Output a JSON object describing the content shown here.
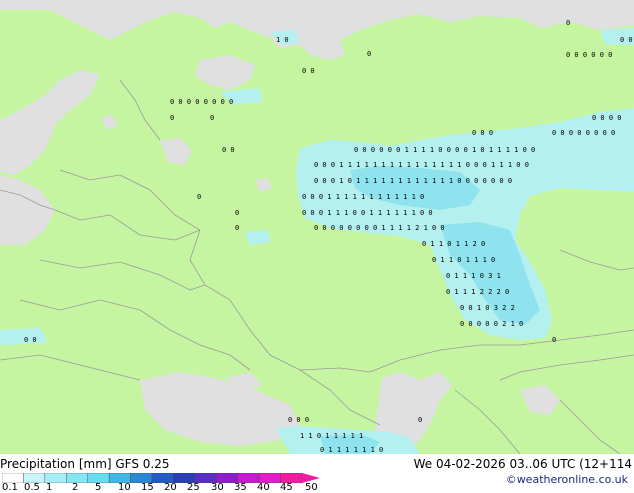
{
  "footer": {
    "title": "Precipitation [mm]  GFS 0.25",
    "valid": "We 04-02-2026 03..06 UTC (12+114",
    "credit": "©weatheronline.co.uk"
  },
  "legend": {
    "ticks": [
      "0.1",
      "0.5",
      "1",
      "2",
      "5",
      "10",
      "15",
      "20",
      "25",
      "30",
      "35",
      "40",
      "45",
      "50"
    ],
    "colors": [
      "#ffffff",
      "#c8f5fa",
      "#a6eef7",
      "#86e5f3",
      "#66dcee",
      "#3fb6e6",
      "#2c86d6",
      "#235cc4",
      "#2a3fb4",
      "#5a2ec2",
      "#8e1fc8",
      "#c21ccf",
      "#e21cc8",
      "#f21ca0"
    ]
  },
  "map_colors": {
    "land": "#c6f5a2",
    "sea": "#e0e0e0",
    "precip_light": "#b4f0ef",
    "precip_med": "#8fe3ee",
    "border": "#9a9a9a"
  }
}
